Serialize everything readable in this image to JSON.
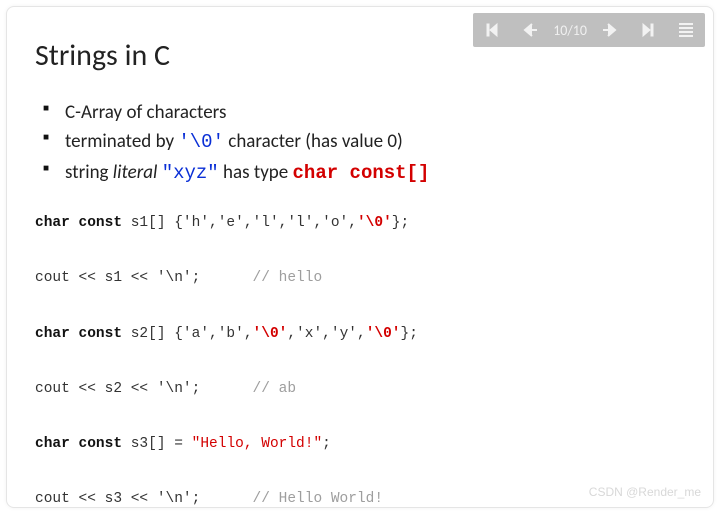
{
  "toolbar": {
    "page_label": "10/10"
  },
  "title": "Strings in C",
  "bullets": {
    "b1": "C-Array of characters",
    "b2a": "terminated by ",
    "b2b": "'\\0'",
    "b2c": " character (has value 0)",
    "b3a": "string ",
    "b3b": "literal",
    "b3c": " ",
    "b3d": "\"xyz\"",
    "b3e": " has type ",
    "b3f": "char  const[]"
  },
  "code": {
    "l1a": "char const",
    "l1b": " s1[] {'h','e','l','l','o',",
    "l1c": "'\\0'",
    "l1d": "};",
    "l2a": "cout << s1 << '\\n';      ",
    "l2b": "// hello",
    "l3a": "char const",
    "l3b": " s2[] {'a','b',",
    "l3c": "'\\0'",
    "l3d": ",'x','y',",
    "l3e": "'\\0'",
    "l3f": "};",
    "l4a": "cout << s2 << '\\n';      ",
    "l4b": "// ab",
    "l5a": "char const",
    "l5b": " s3[] = ",
    "l5c": "\"Hello, World!\"",
    "l5d": ";",
    "l6a": "cout << s3 << '\\n';      ",
    "l6b": "// Hello World!"
  },
  "watermark": "CSDN @Render_me",
  "chart_data": {
    "type": "table",
    "title": "Strings in C",
    "examples": [
      {
        "decl": "char const s1[] {'h','e','l','l','o','\\0'};",
        "output": "hello"
      },
      {
        "decl": "char const s2[] {'a','b','\\0','x','y','\\0'};",
        "output": "ab"
      },
      {
        "decl": "char const s3[] = \"Hello, World!\";",
        "output": "Hello World!"
      }
    ]
  }
}
